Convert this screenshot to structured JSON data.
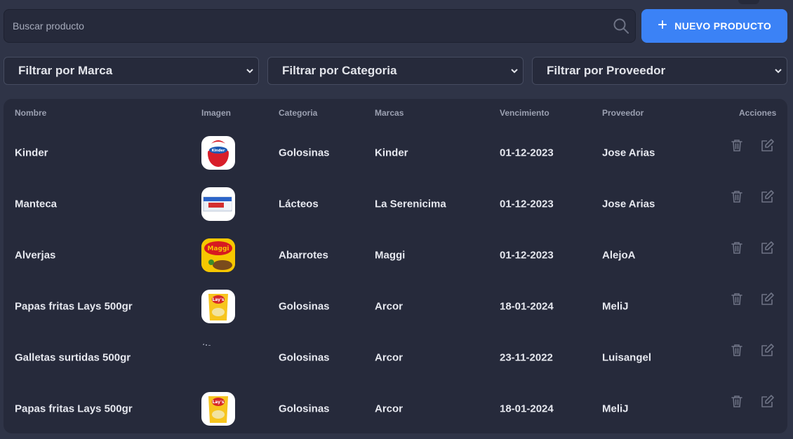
{
  "search": {
    "placeholder": "Buscar producto"
  },
  "new_button": {
    "label": "NUEVO PRODUCTO"
  },
  "filters": {
    "brand": "Filtrar por Marca",
    "category": "Filtrar por Categoria",
    "supplier": "Filtrar por Proveedor"
  },
  "table": {
    "headers": [
      "Nombre",
      "Imagen",
      "Categoria",
      "Marcas",
      "Vencimiento",
      "Proveedor",
      "Acciones"
    ],
    "rows": [
      {
        "name": "Kinder",
        "image": "kinder-surprise-egg",
        "category": "Golosinas",
        "brand": "Kinder",
        "expiry": "01-12-2023",
        "supplier": "Jose Arias"
      },
      {
        "name": "Manteca",
        "image": "butter-pack",
        "category": "Lácteos",
        "brand": "La Serenicima",
        "expiry": "01-12-2023",
        "supplier": "Jose Arias"
      },
      {
        "name": "Alverjas",
        "image": "maggi-pack",
        "category": "Abarrotes",
        "brand": "Maggi",
        "expiry": "01-12-2023",
        "supplier": "AlejoA"
      },
      {
        "name": "Papas fritas Lays 500gr",
        "image": "lays-chips-bag",
        "category": "Golosinas",
        "brand": "Arcor",
        "expiry": "18-01-2024",
        "supplier": "MeliJ"
      },
      {
        "name": "Galletas surtidas 500gr",
        "image": "broken-image",
        "category": "Golosinas",
        "brand": "Arcor",
        "expiry": "23-11-2022",
        "supplier": "Luisangel"
      },
      {
        "name": "Papas fritas Lays 500gr",
        "image": "lays-chips-bag",
        "category": "Golosinas",
        "brand": "Arcor",
        "expiry": "18-01-2024",
        "supplier": "MeliJ"
      }
    ]
  },
  "icons": {
    "search": "search-icon",
    "plus": "plus-icon",
    "chevron": "chevron-down-icon",
    "delete": "trash-icon",
    "edit": "edit-icon"
  },
  "colors": {
    "background": "#2f3447",
    "panel": "#262a3b",
    "accent": "#3b82f6",
    "header_text": "#9ba0b1",
    "icon": "#6e7385"
  }
}
